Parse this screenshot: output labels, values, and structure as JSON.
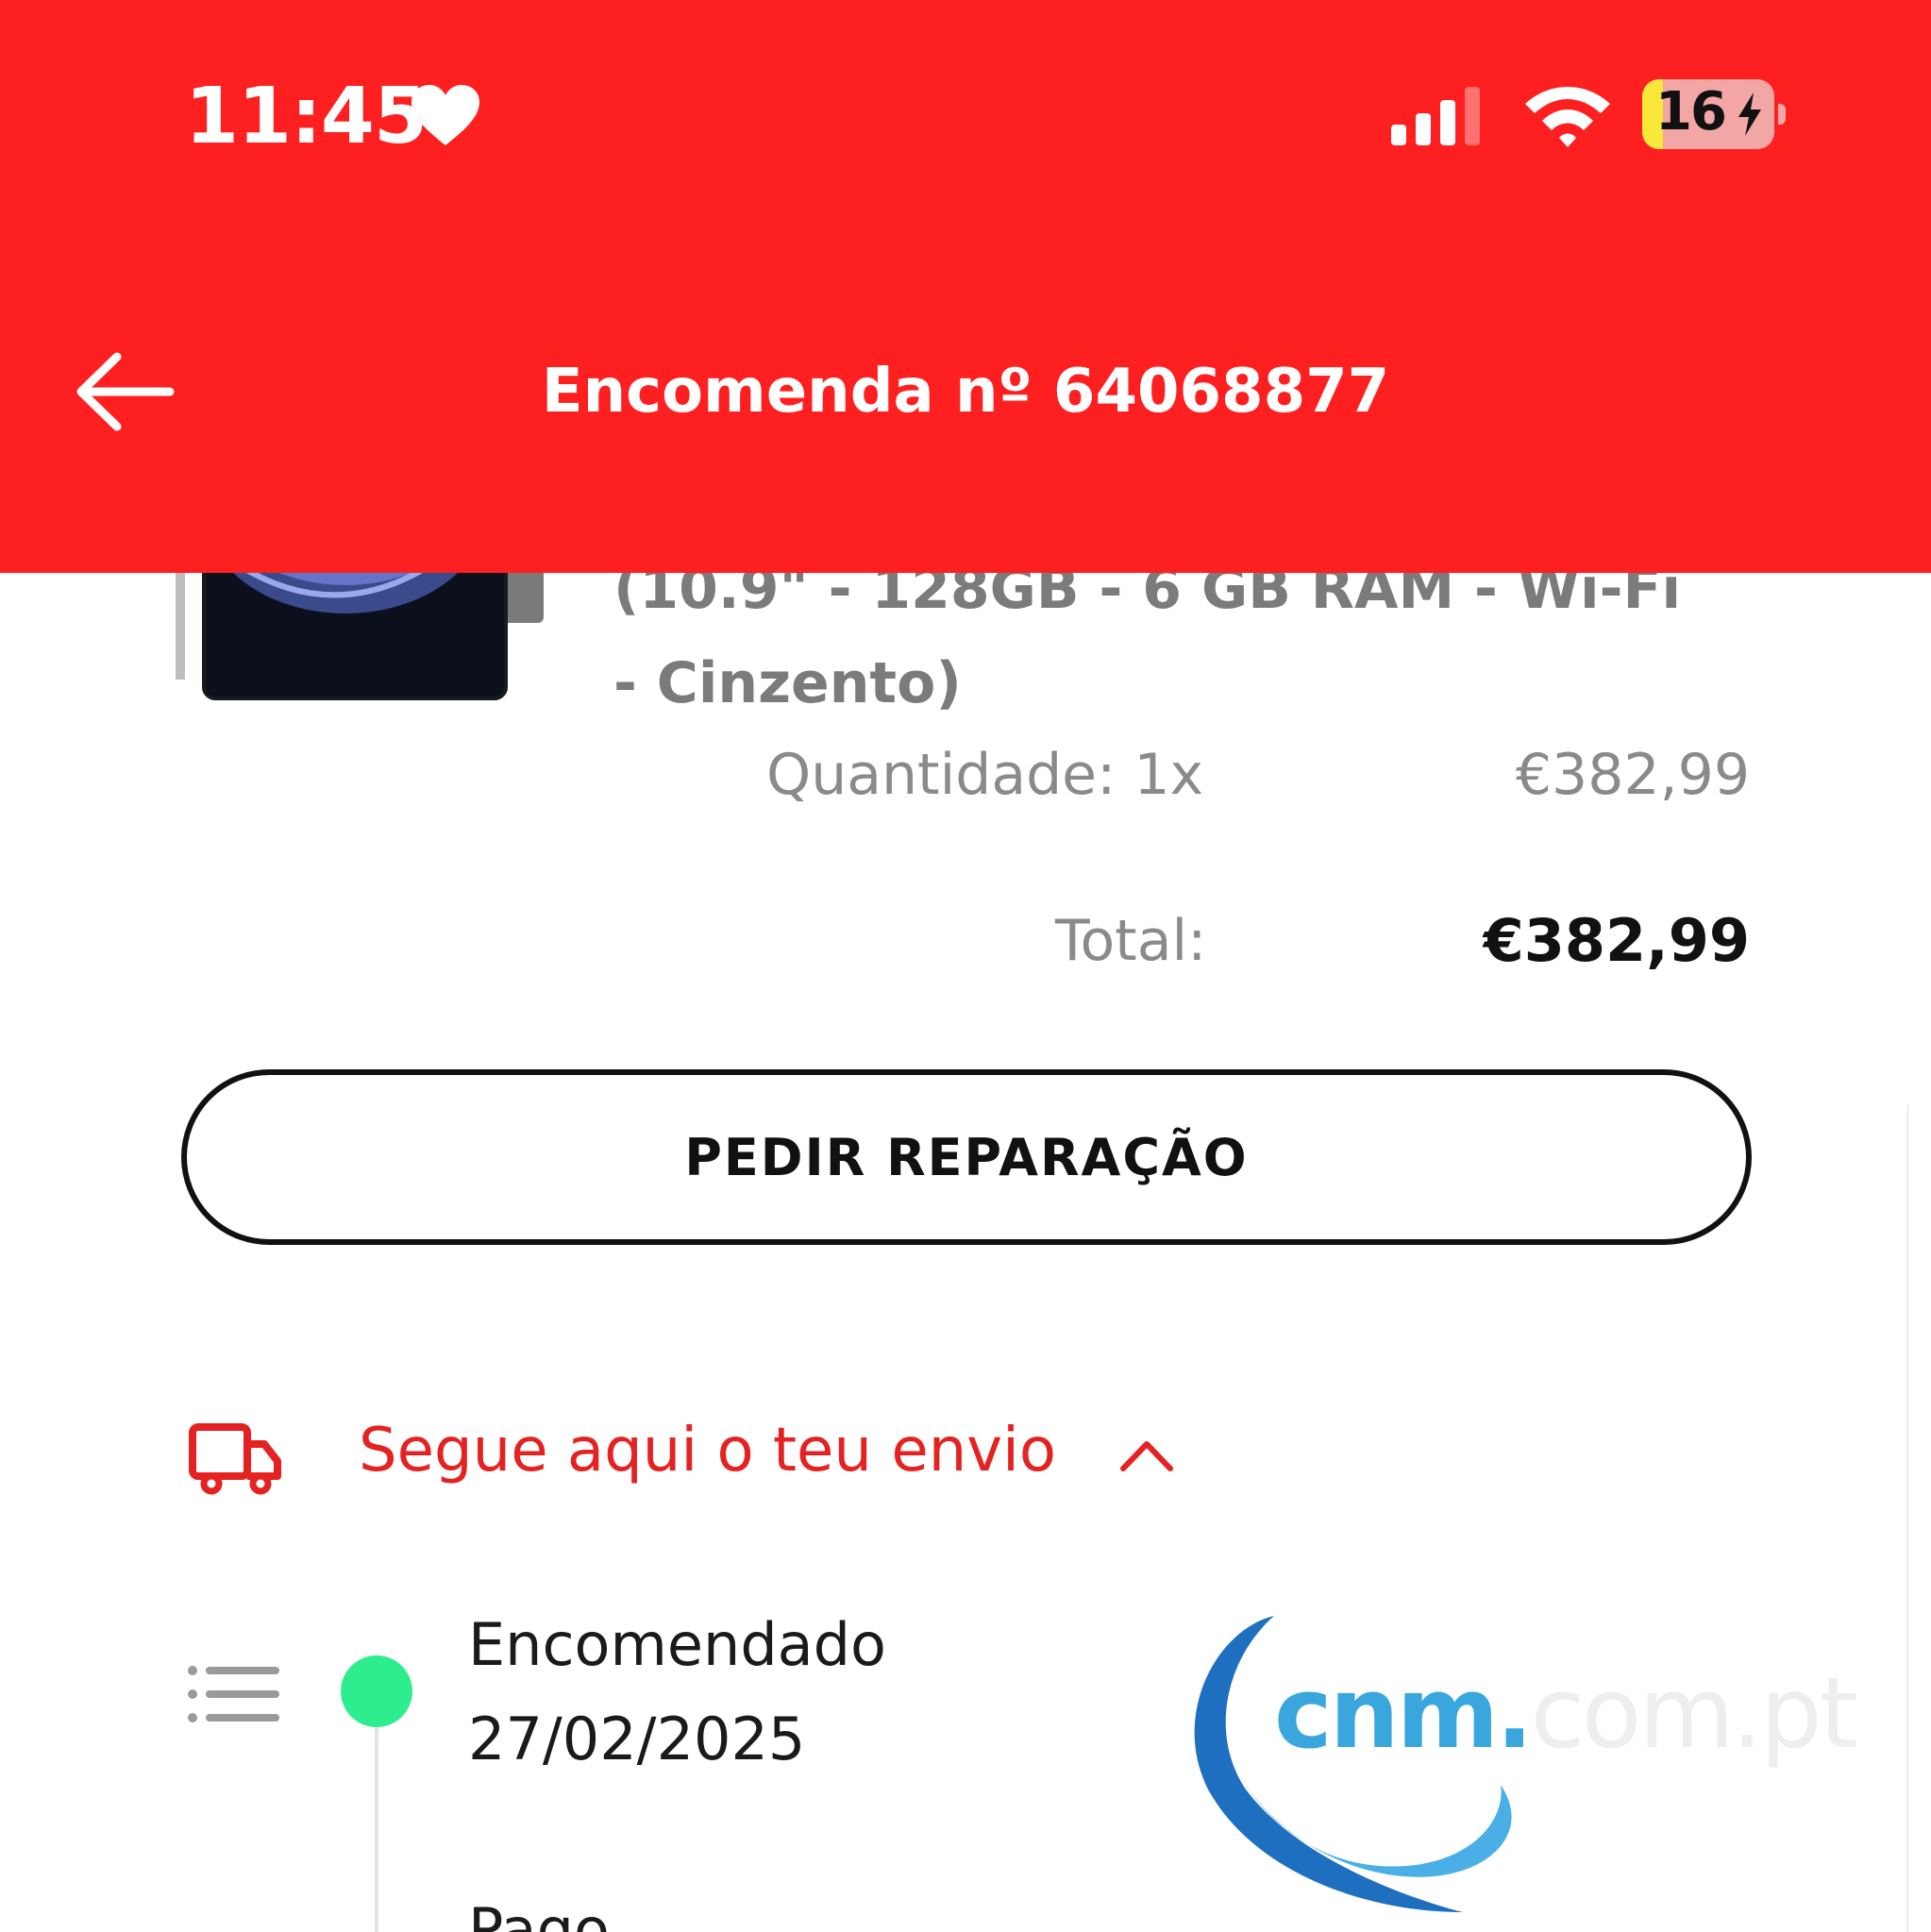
{
  "status_bar": {
    "time": "11:45",
    "battery_level": "16",
    "battery_fraction": 0.16
  },
  "header": {
    "title": "Encomenda nº 64068877",
    "back_icon": "arrow-left-icon"
  },
  "order_item": {
    "name": "(10.9\" - 128GB - 6 GB RAM - Wi-Fi - Cinzento)",
    "quantity_label": "Quantidade: 1x",
    "price": "€382,99"
  },
  "totals": {
    "label": "Total:",
    "value": "€382,99"
  },
  "actions": {
    "repair_label": "PEDIR REPARAÇÃO"
  },
  "tracking": {
    "toggle_label": "Segue aqui o teu envio",
    "steps": [
      {
        "label": "Encomendado",
        "date": "27/02/2025"
      },
      {
        "label": "Pago"
      }
    ]
  },
  "watermark": {
    "brand": "cnm.",
    "suffix": "com.pt"
  },
  "colors": {
    "brand_red": "#fe2020",
    "tracking_red": "#e52222",
    "status_green": "#2ded8e",
    "watermark_blue": "#3aa6de"
  }
}
